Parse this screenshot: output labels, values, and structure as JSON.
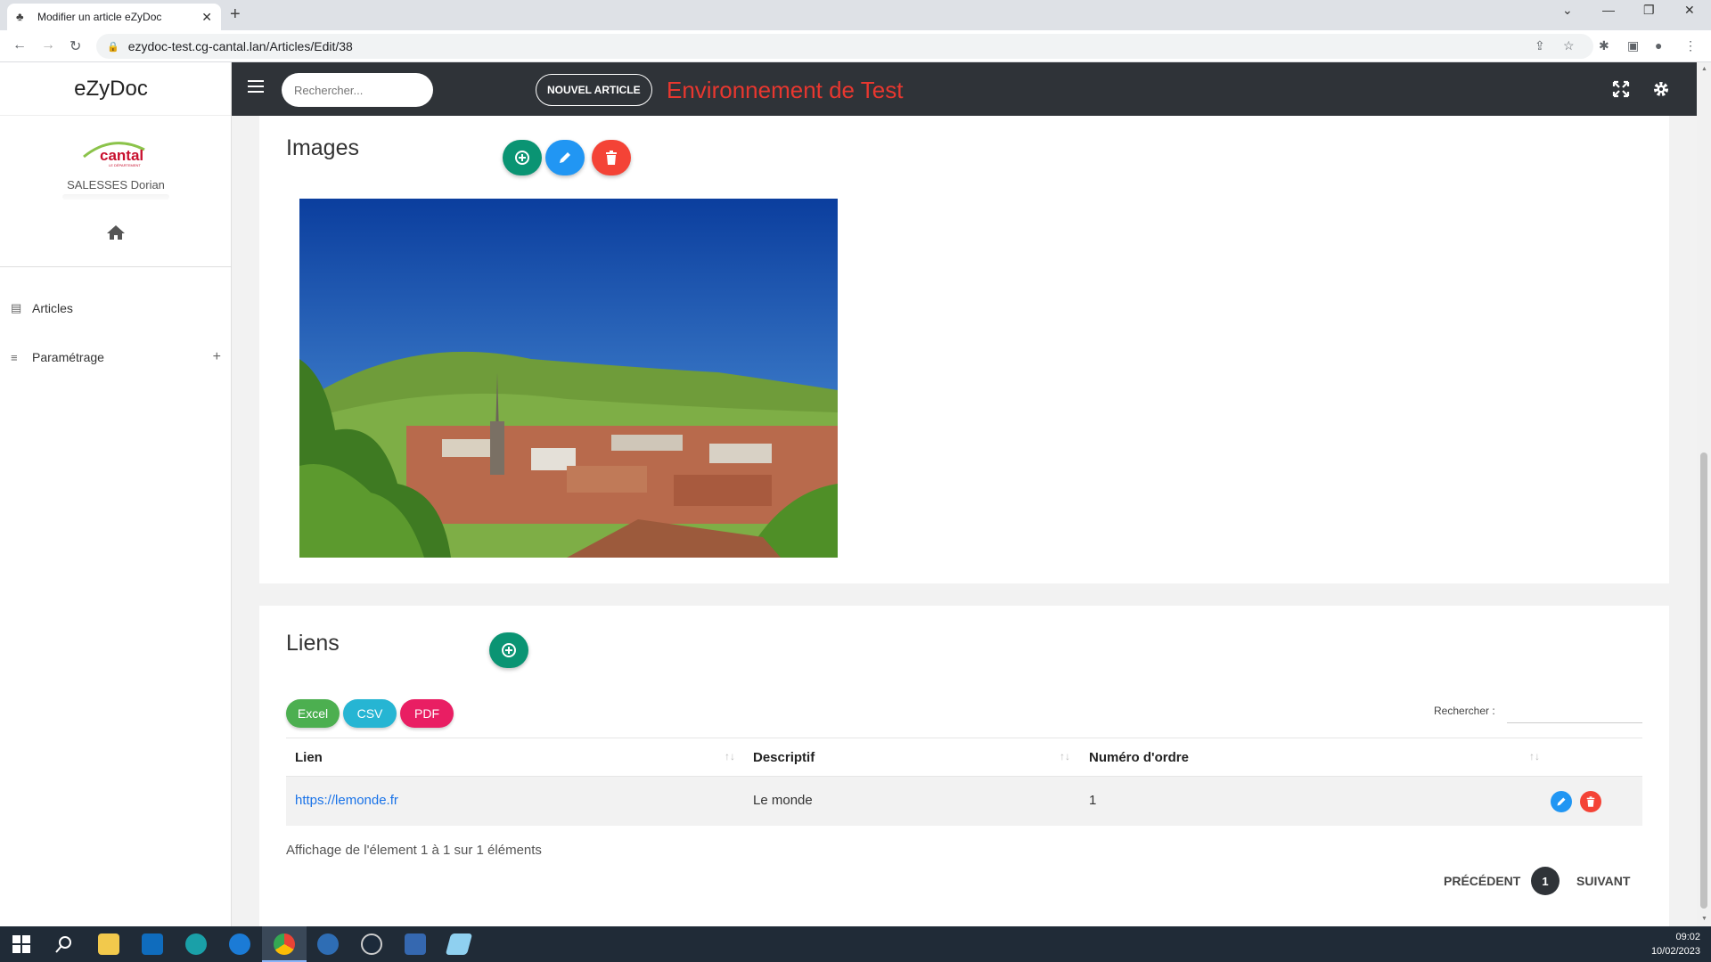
{
  "browser": {
    "tab_title": "Modifier un article eZyDoc",
    "url": "ezydoc-test.cg-cantal.lan/Articles/Edit/38"
  },
  "sidebar": {
    "brand": "eZyDoc",
    "logo_text": "cantal",
    "logo_sub": "LE DÉPARTEMENT",
    "user": "SALESSES Dorian",
    "items": [
      {
        "label": "Articles",
        "icon": "file-icon"
      },
      {
        "label": "Paramétrage",
        "icon": "list-icon",
        "expand": "+"
      }
    ]
  },
  "header": {
    "search_placeholder": "Rechercher...",
    "new_article": "NOUVEL ARTICLE",
    "environment": "Environnement de Test"
  },
  "images_section": {
    "title": "Images"
  },
  "links_section": {
    "title": "Liens",
    "export_buttons": [
      "Excel",
      "CSV",
      "PDF"
    ],
    "search_label": "Rechercher :",
    "columns": [
      "Lien",
      "Descriptif",
      "Numéro d'ordre"
    ],
    "rows": [
      {
        "lien": "https://lemonde.fr",
        "descriptif": "Le monde",
        "ordre": "1"
      }
    ],
    "info": "Affichage de l'élement 1 à 1 sur 1 éléments",
    "prev": "PRÉCÉDENT",
    "page": "1",
    "next": "SUIVANT"
  },
  "taskbar": {
    "time": "09:02",
    "date": "10/02/2023"
  },
  "colors": {
    "topbar": "#2f3338",
    "env_red": "#e8372f",
    "green": "#0a9473",
    "blue": "#2196f3",
    "red": "#f44336"
  }
}
